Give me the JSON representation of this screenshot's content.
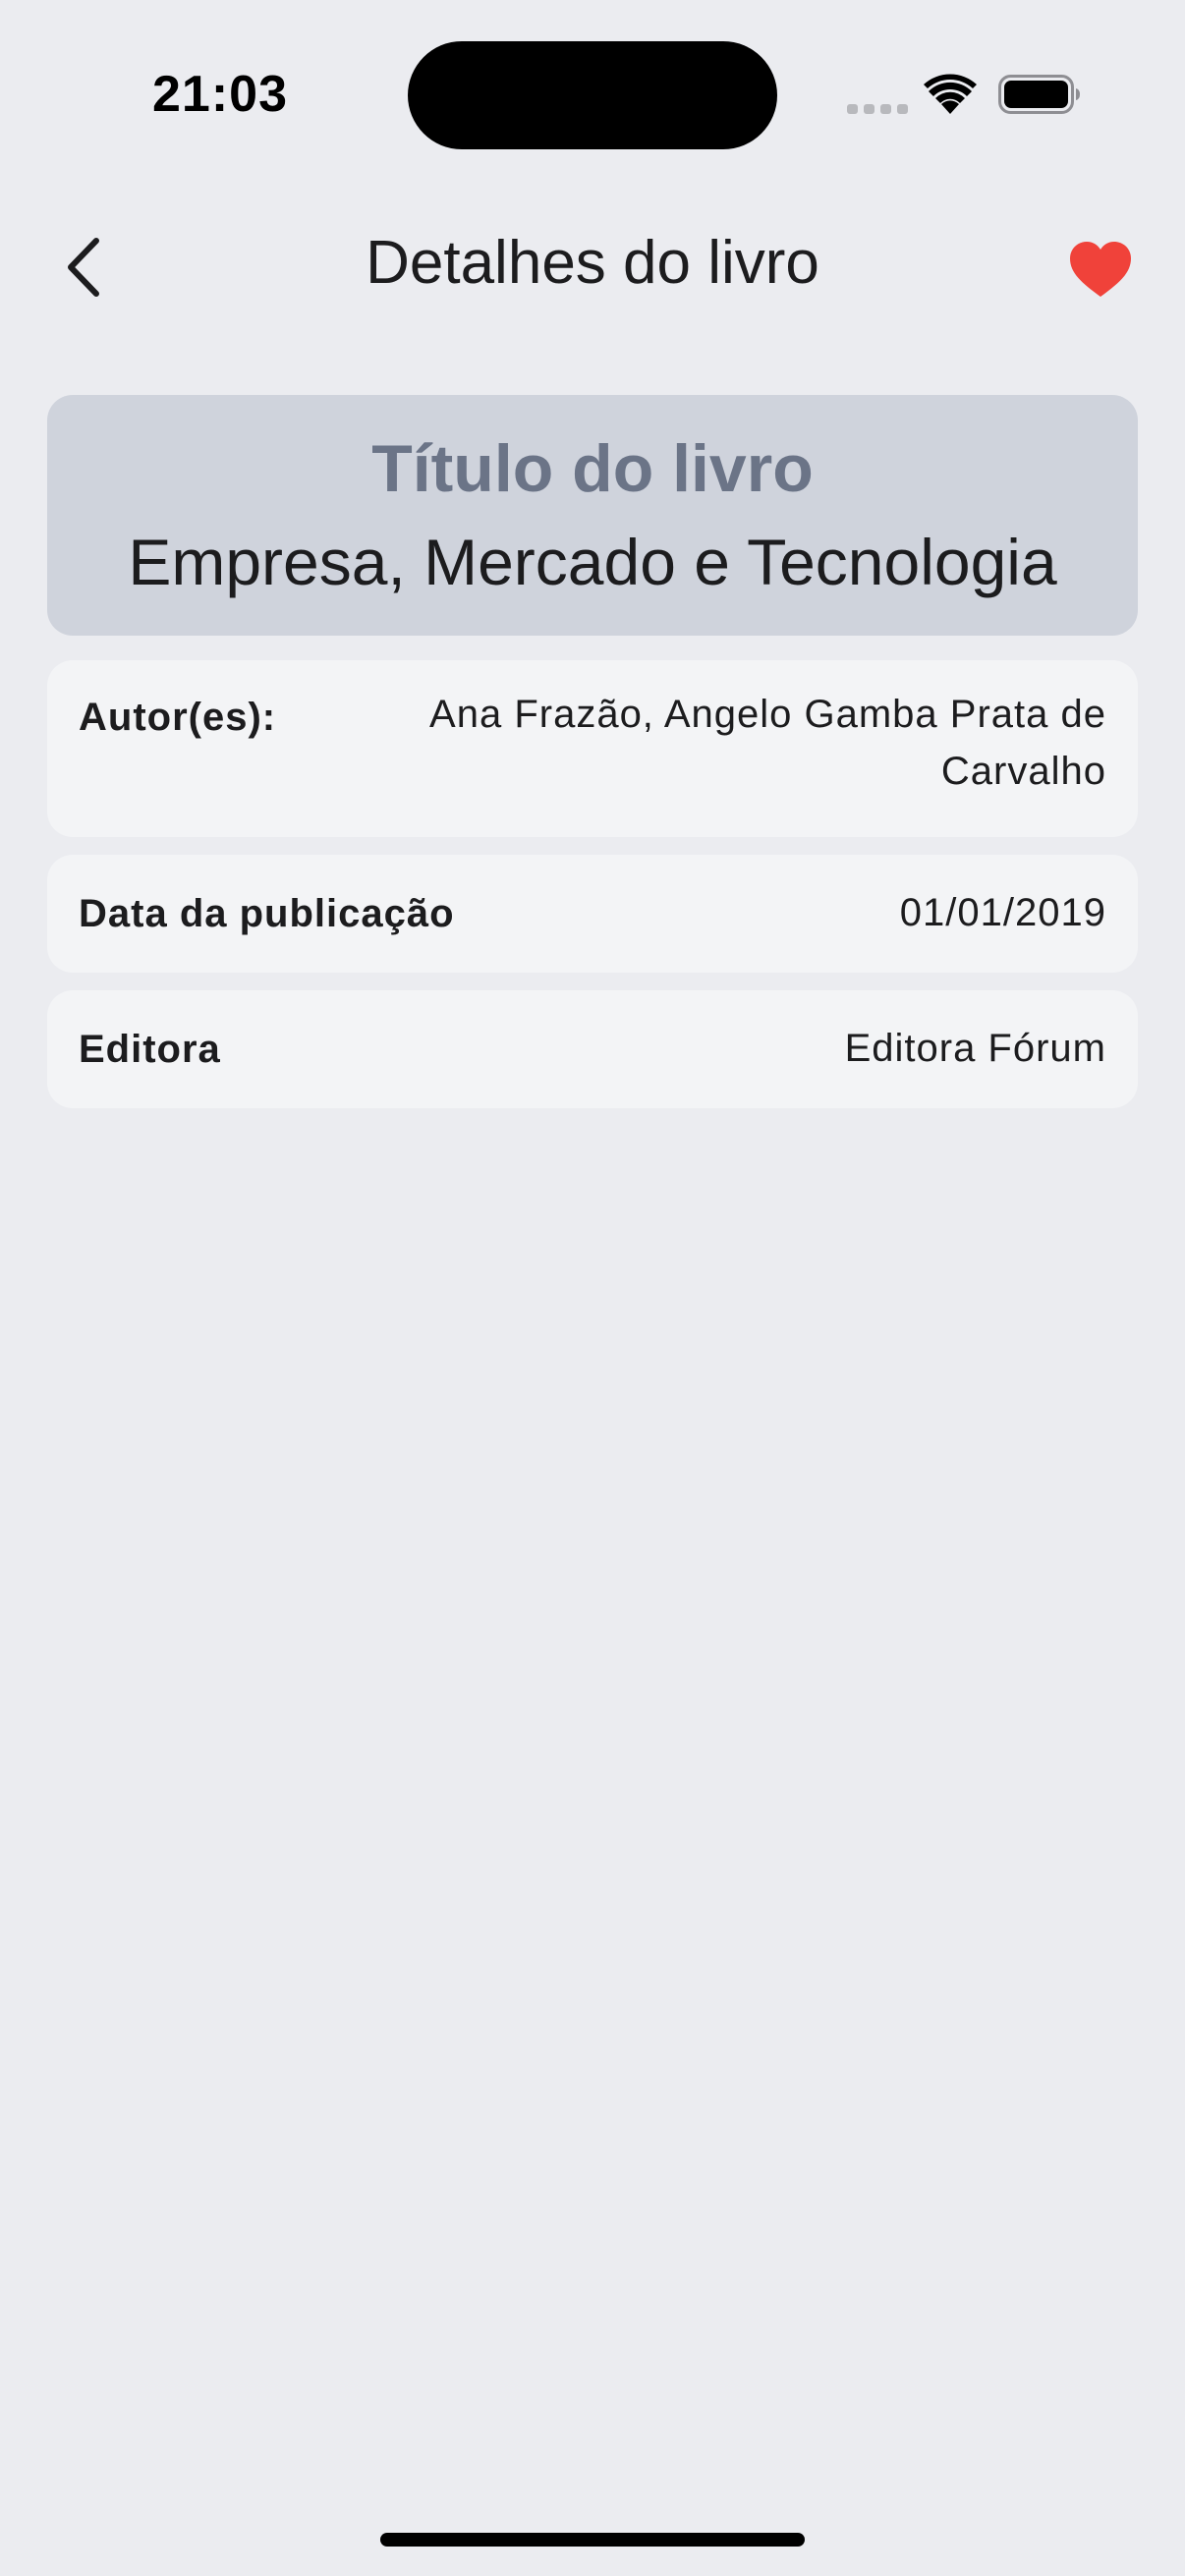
{
  "status_bar": {
    "time": "21:03",
    "icons": [
      "signal-icon",
      "wifi-icon",
      "battery-icon"
    ]
  },
  "nav": {
    "title": "Detalhes do livro",
    "back_icon": "chevron-left-icon",
    "favorite_icon": "heart-icon",
    "favorite_color": "#f0423a",
    "favorited": true
  },
  "book": {
    "title_label": "Título do livro",
    "title": "Empresa, Mercado e Tecnologia",
    "details": [
      {
        "label": "Autor(es):",
        "value": "Ana Frazão, Angelo Gamba Prata de Carvalho"
      },
      {
        "label": "Data da publicação",
        "value": "01/01/2019"
      },
      {
        "label": "Editora",
        "value": "Editora Fórum"
      }
    ]
  },
  "colors": {
    "background": "#ebecf0",
    "title_card": "#cfd3dc",
    "title_label": "#6b7487",
    "row_background": "#f3f4f6"
  }
}
